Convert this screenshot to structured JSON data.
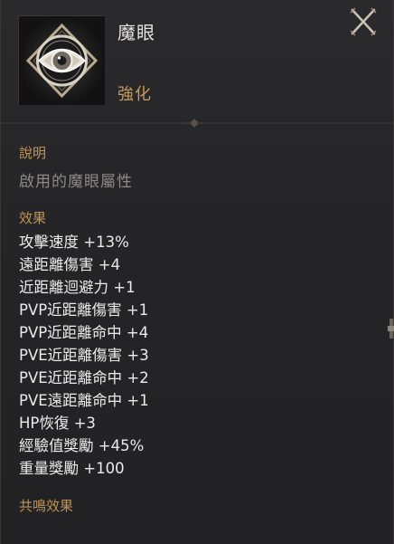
{
  "item": {
    "name": "魔眼",
    "icon": "eye-emblem-icon",
    "enhance_label": "強化"
  },
  "close": {
    "icon": "close-x-icon"
  },
  "description": {
    "label": "說明",
    "text": "啟用的魔眼屬性"
  },
  "effects": {
    "label": "效果",
    "items": [
      "攻擊速度 +13%",
      "遠距離傷害 +4",
      "近距離迴避力 +1",
      "PVP近距離傷害 +1",
      "PVP近距離命中 +4",
      "PVE近距離傷害 +3",
      "PVE近距離命中 +2",
      "PVE遠距離命中 +1",
      "HP恢復 +3",
      "經驗值獎勵 +45%",
      "重量獎勵 +100"
    ]
  },
  "resonance": {
    "label": "共鳴效果"
  },
  "colors": {
    "accent_gold": "#c69a58",
    "label_gold": "#bf9454",
    "text_main": "#ecebe8",
    "text_muted": "#8d8a85",
    "background": "#232325"
  }
}
